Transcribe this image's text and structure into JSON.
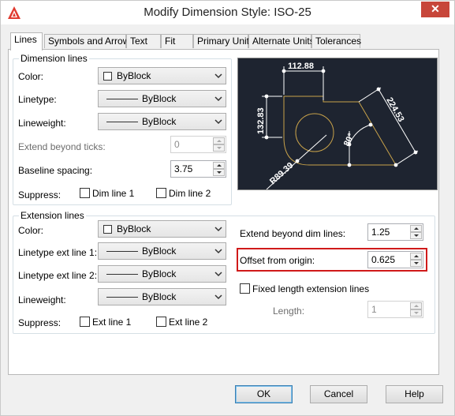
{
  "window": {
    "title": "Modify Dimension Style: ISO-25",
    "close_glyph": "✕"
  },
  "tabs": [
    {
      "label": "Lines"
    },
    {
      "label": "Symbols and Arrows"
    },
    {
      "label": "Text"
    },
    {
      "label": "Fit"
    },
    {
      "label": "Primary Units"
    },
    {
      "label": "Alternate Units"
    },
    {
      "label": "Tolerances"
    }
  ],
  "dimension_lines": {
    "group_label": "Dimension lines",
    "color": {
      "label": "Color:",
      "value": "ByBlock"
    },
    "linetype": {
      "label": "Linetype:",
      "value": "ByBlock"
    },
    "lineweight": {
      "label": "Lineweight:",
      "value": "ByBlock"
    },
    "extend_beyond_ticks": {
      "label": "Extend beyond ticks:",
      "value": "0"
    },
    "baseline_spacing": {
      "label": "Baseline spacing:",
      "value": "3.75"
    },
    "suppress": {
      "label": "Suppress:",
      "dim_line_1": "Dim line 1",
      "dim_line_2": "Dim line 2"
    }
  },
  "extension_lines": {
    "group_label": "Extension lines",
    "color": {
      "label": "Color:",
      "value": "ByBlock"
    },
    "linetype_ext_line_1": {
      "label": "Linetype ext line 1:",
      "value": "ByBlock"
    },
    "linetype_ext_line_2": {
      "label": "Linetype ext line 2:",
      "value": "ByBlock"
    },
    "lineweight": {
      "label": "Lineweight:",
      "value": "ByBlock"
    },
    "suppress": {
      "label": "Suppress:",
      "ext_line_1": "Ext line 1",
      "ext_line_2": "Ext line 2"
    },
    "extend_beyond_dim_lines": {
      "label": "Extend beyond dim lines:",
      "value": "1.25"
    },
    "offset_from_origin": {
      "label": "Offset from origin:",
      "value": "0.625"
    },
    "fixed_length": {
      "label": "Fixed length extension lines"
    },
    "length": {
      "label": "Length:",
      "value": "1"
    }
  },
  "preview": {
    "dim_top": "112.88",
    "dim_left": "132.83",
    "dim_right": "224.53",
    "dim_radius": "R89.39",
    "dim_angle": "80°"
  },
  "buttons": {
    "ok": "OK",
    "cancel": "Cancel",
    "help": "Help"
  },
  "colors": {
    "highlight": "#d01a1a",
    "preview_bg": "#1e2430",
    "preview_geometry": "#c8a24a"
  }
}
